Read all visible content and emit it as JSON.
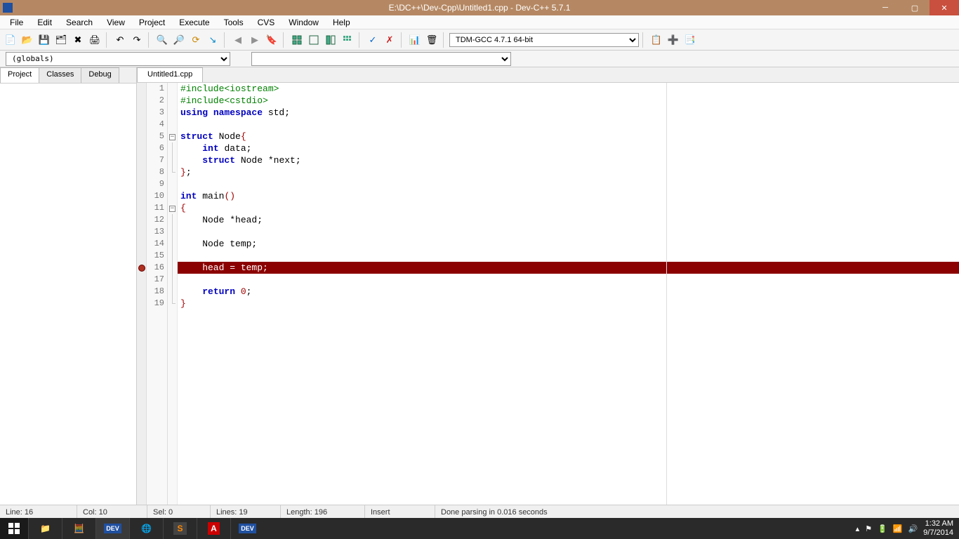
{
  "title": "E:\\DC++\\Dev-Cpp\\Untitled1.cpp - Dev-C++ 5.7.1",
  "menu": [
    "File",
    "Edit",
    "Search",
    "View",
    "Project",
    "Execute",
    "Tools",
    "CVS",
    "Window",
    "Help"
  ],
  "compiler": "TDM-GCC 4.7.1 64-bit",
  "scope": "(globals)",
  "sidetabs": [
    "Project",
    "Classes",
    "Debug"
  ],
  "filetab": "Untitled1.cpp",
  "code": {
    "lines": [
      {
        "n": "1",
        "tokens": [
          [
            "#include<iostream>",
            "kw-green"
          ]
        ]
      },
      {
        "n": "2",
        "tokens": [
          [
            "#include<cstdio>",
            "kw-green"
          ]
        ]
      },
      {
        "n": "3",
        "tokens": [
          [
            "using ",
            "kw-blue"
          ],
          [
            "namespace ",
            "kw-blue"
          ],
          [
            "std",
            ""
          ],
          [
            ";",
            ""
          ]
        ]
      },
      {
        "n": "4",
        "tokens": [
          [
            "",
            ""
          ]
        ]
      },
      {
        "n": "5",
        "tokens": [
          [
            "struct ",
            "kw-blue"
          ],
          [
            "Node",
            ""
          ],
          [
            "{",
            "brace"
          ]
        ],
        "fold": "start"
      },
      {
        "n": "6",
        "tokens": [
          [
            "    ",
            ""
          ],
          [
            "int ",
            "kw-blue"
          ],
          [
            "data",
            ""
          ],
          [
            ";",
            ""
          ]
        ],
        "fold": "mid"
      },
      {
        "n": "7",
        "tokens": [
          [
            "    ",
            ""
          ],
          [
            "struct ",
            "kw-blue"
          ],
          [
            "Node ",
            ""
          ],
          [
            "*",
            ""
          ],
          [
            "next",
            ""
          ],
          [
            ";",
            ""
          ]
        ],
        "fold": "mid"
      },
      {
        "n": "8",
        "tokens": [
          [
            "}",
            "brace"
          ],
          [
            ";",
            ""
          ]
        ],
        "fold": "end"
      },
      {
        "n": "9",
        "tokens": [
          [
            "",
            ""
          ]
        ]
      },
      {
        "n": "10",
        "tokens": [
          [
            "int ",
            "kw-blue"
          ],
          [
            "main",
            ""
          ],
          [
            "()",
            "brace"
          ]
        ]
      },
      {
        "n": "11",
        "tokens": [
          [
            "{",
            "brace"
          ]
        ],
        "fold": "start"
      },
      {
        "n": "12",
        "tokens": [
          [
            "    Node ",
            ""
          ],
          [
            "*",
            ""
          ],
          [
            "head",
            ""
          ],
          [
            ";",
            ""
          ]
        ],
        "fold": "mid"
      },
      {
        "n": "13",
        "tokens": [
          [
            "",
            ""
          ]
        ],
        "fold": "mid"
      },
      {
        "n": "14",
        "tokens": [
          [
            "    Node temp",
            ""
          ],
          [
            ";",
            ""
          ]
        ],
        "fold": "mid"
      },
      {
        "n": "15",
        "tokens": [
          [
            "",
            ""
          ]
        ],
        "fold": "mid"
      },
      {
        "n": "16",
        "tokens": [
          [
            "    head = temp;",
            ""
          ]
        ],
        "fold": "mid",
        "error": true,
        "bp": true
      },
      {
        "n": "17",
        "tokens": [
          [
            "",
            ""
          ]
        ],
        "fold": "mid"
      },
      {
        "n": "18",
        "tokens": [
          [
            "    ",
            ""
          ],
          [
            "return ",
            "kw-blue"
          ],
          [
            "0",
            "kw-red"
          ],
          [
            ";",
            ""
          ]
        ],
        "fold": "mid"
      },
      {
        "n": "19",
        "tokens": [
          [
            "}",
            "brace"
          ]
        ],
        "fold": "end"
      }
    ]
  },
  "status": {
    "line": "Line:   16",
    "col": "Col:   10",
    "sel": "Sel:   0",
    "lines": "Lines:   19",
    "length": "Length:   196",
    "mode": "Insert",
    "msg": "Done parsing in 0.016 seconds"
  },
  "tray": {
    "time": "1:32 AM",
    "date": "9/7/2014"
  }
}
